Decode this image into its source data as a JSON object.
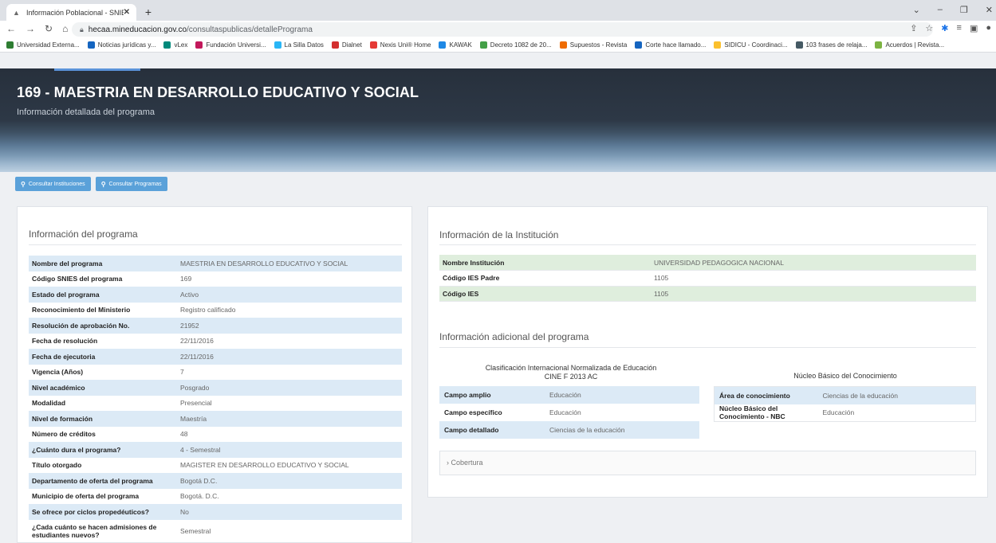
{
  "browser": {
    "tab_title": "Información Poblacional - SNIES",
    "url_domain": "hecaa.mineducacion.gov.co",
    "url_path": "/consultaspublicas/detallePrograma",
    "bookmarks": [
      {
        "label": "Universidad Externa...",
        "color": "#2e7d32"
      },
      {
        "label": "Noticias jurídicas y...",
        "color": "#1565c0"
      },
      {
        "label": "vLex",
        "color": "#00897b"
      },
      {
        "label": "Fundación Universi...",
        "color": "#c2185b"
      },
      {
        "label": "La Silla Datos",
        "color": "#29b6f6"
      },
      {
        "label": "Dialnet",
        "color": "#d32f2f"
      },
      {
        "label": "Nexis Uni® Home",
        "color": "#e53935"
      },
      {
        "label": "KAWAK",
        "color": "#1e88e5"
      },
      {
        "label": "Decreto 1082 de 20...",
        "color": "#43a047"
      },
      {
        "label": "Supuestos - Revista",
        "color": "#ef6c00"
      },
      {
        "label": "Corte hace llamado...",
        "color": "#1565c0"
      },
      {
        "label": "SIDICU - Coordinaci...",
        "color": "#fbc02d"
      },
      {
        "label": "103 frases de relaja...",
        "color": "#455a64"
      },
      {
        "label": "Acuerdos | Revista...",
        "color": "#7cb342"
      }
    ]
  },
  "hero": {
    "title": "169 - MAESTRIA EN DESARROLLO EDUCATIVO Y SOCIAL",
    "subtitle": "Información detallada del programa"
  },
  "buttons": {
    "instituciones": "Consultar Instituciones",
    "programas": "Consultar Programas"
  },
  "programa": {
    "title": "Información del programa",
    "rows": [
      {
        "k": "Nombre del programa",
        "v": "MAESTRIA EN DESARROLLO EDUCATIVO Y SOCIAL"
      },
      {
        "k": "Código SNIES del programa",
        "v": "169"
      },
      {
        "k": "Estado del programa",
        "v": "Activo"
      },
      {
        "k": "Reconocimiento del Ministerio",
        "v": "Registro calificado"
      },
      {
        "k": "Resolución de aprobación No.",
        "v": "21952"
      },
      {
        "k": "Fecha de resolución",
        "v": "22/11/2016"
      },
      {
        "k": "Fecha de ejecutoria",
        "v": "22/11/2016"
      },
      {
        "k": "Vigencia (Años)",
        "v": "7"
      },
      {
        "k": "Nivel académico",
        "v": "Posgrado"
      },
      {
        "k": "Modalidad",
        "v": "Presencial"
      },
      {
        "k": "Nivel de formación",
        "v": "Maestría"
      },
      {
        "k": "Número de créditos",
        "v": "48"
      },
      {
        "k": "¿Cuánto dura el programa?",
        "v": "4 - Semestral"
      },
      {
        "k": "Título otorgado",
        "v": "MAGISTER EN DESARROLLO EDUCATIVO Y SOCIAL"
      },
      {
        "k": "Departamento de oferta del programa",
        "v": "Bogotá D.C."
      },
      {
        "k": "Municipio de oferta del programa",
        "v": "Bogotá. D.C."
      },
      {
        "k": "Se ofrece por ciclos propedéuticos?",
        "v": "No"
      },
      {
        "k": "¿Cada cuánto se hacen admisiones de estudiantes nuevos?",
        "v": "Semestral"
      }
    ]
  },
  "institucion": {
    "title": "Información de la Institución",
    "rows": [
      {
        "k": "Nombre Institución",
        "v": "UNIVERSIDAD PEDAGOGICA NACIONAL"
      },
      {
        "k": "Código IES Padre",
        "v": "1105"
      },
      {
        "k": "Código IES",
        "v": "1105"
      }
    ]
  },
  "adicional": {
    "title": "Información adicional del programa",
    "cine_header_1": "Clasificación Internacional Normalizada de Educación",
    "cine_header_2": "CINE F 2013 AC",
    "cine_rows": [
      {
        "k": "Campo amplio",
        "v": "Educación"
      },
      {
        "k": "Campo específico",
        "v": "Educación"
      },
      {
        "k": "Campo detallado",
        "v": "Ciencias de la educación"
      }
    ],
    "nbc_header": "Núcleo Básico del Conocimiento",
    "nbc_rows": [
      {
        "k": "Área de conocimiento",
        "v": "Ciencias de la educación"
      },
      {
        "k": "Núcleo Básico del Conocimiento - NBC",
        "v": "Educación"
      }
    ],
    "cobertura": "› Cobertura"
  }
}
